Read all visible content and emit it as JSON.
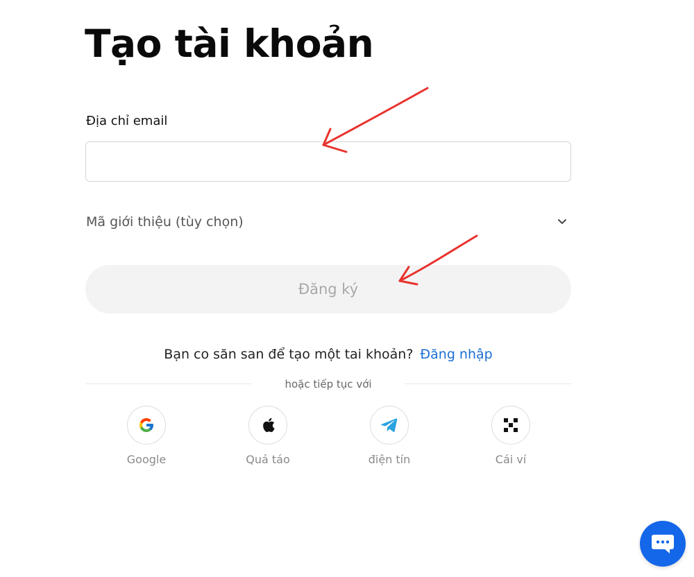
{
  "page": {
    "title": "Tạo tài khoản"
  },
  "email": {
    "label": "Địa chỉ email",
    "value": "",
    "placeholder": ""
  },
  "referral": {
    "label": "Mã giới thiệu (tùy chọn)",
    "icon": "chevron-down-icon"
  },
  "signup": {
    "label": "Đăng ký",
    "state": "disabled"
  },
  "login": {
    "prompt": "Bạn co săn san để tạo một tai khoản?",
    "link": "Đăng nhập",
    "link_color": "#1a6fd4"
  },
  "divider": {
    "text": "hoặc tiếp tục với"
  },
  "social": [
    {
      "label": "Google",
      "icon": "google-icon"
    },
    {
      "label": "Quả táo",
      "icon": "apple-icon"
    },
    {
      "label": "điện tín",
      "icon": "telegram-icon"
    },
    {
      "label": "Cái ví",
      "icon": "wallet-icon"
    }
  ],
  "annotations": {
    "arrow_color": "#e8322e"
  },
  "chat": {
    "icon": "chat-bubble-icon",
    "color": "#1467e8"
  }
}
